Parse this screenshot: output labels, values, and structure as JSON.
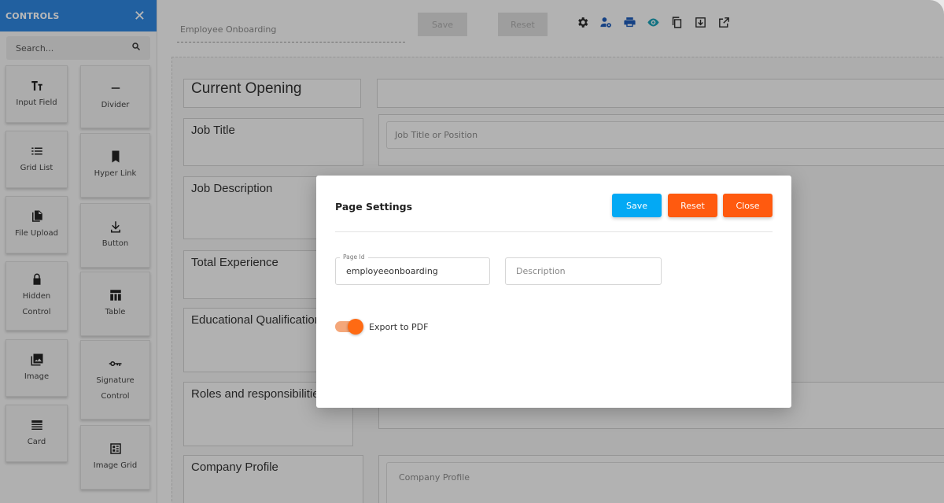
{
  "sidebar": {
    "title": "CONTROLS",
    "close_icon": "close-icon",
    "search_placeholder": "Search...",
    "controls": [
      {
        "label": "Input Field",
        "icon": "text-format-icon"
      },
      {
        "label": "Divider",
        "icon": "minus-icon"
      },
      {
        "label": "Grid List",
        "icon": "list-icon"
      },
      {
        "label": "Hyper Link",
        "icon": "bookmark-icon"
      },
      {
        "label": "File Upload",
        "icon": "file-copy-icon"
      },
      {
        "label": "Button",
        "icon": "download-icon"
      },
      {
        "label": "Hidden Control",
        "label_line1": "Hidden",
        "label_line2": "Control",
        "icon": "lock-icon"
      },
      {
        "label": "Table",
        "icon": "table-icon"
      },
      {
        "label": "Image",
        "icon": "image-icon"
      },
      {
        "label": "Signature Control",
        "label_line1": "Signature",
        "label_line2": "Control",
        "icon": "key-icon"
      },
      {
        "label": "Card",
        "icon": "card-icon"
      },
      {
        "label": "Image Grid",
        "icon": "image-grid-icon"
      }
    ]
  },
  "toolbar": {
    "page_name_value": "Employee Onboarding",
    "save_label": "Save",
    "reset_label": "Reset",
    "icons": [
      "settings-icon",
      "user-settings-icon",
      "print-icon",
      "preview-eye-icon",
      "copy-icon",
      "download-icon",
      "open-external-icon"
    ]
  },
  "form": {
    "rows": [
      {
        "label": "Current Opening",
        "placeholder": ""
      },
      {
        "label": "Job Title",
        "placeholder": "Job Title or Position"
      },
      {
        "label": "Job Description",
        "placeholder": ""
      },
      {
        "label": "Total Experience",
        "placeholder": ""
      },
      {
        "label": "Educational Qualification",
        "placeholder": ""
      },
      {
        "label": "Roles and responsibilities",
        "placeholder": ""
      },
      {
        "label": "Company Profile",
        "placeholder": "Company Profile"
      }
    ]
  },
  "modal": {
    "title": "Page Settings",
    "save_label": "Save",
    "reset_label": "Reset",
    "close_label": "Close",
    "page_id_label": "Page Id",
    "page_id_value": "employeeonboarding",
    "description_placeholder": "Description",
    "export_label": "Export to PDF",
    "export_enabled": true
  },
  "colors": {
    "sidebar_header": "#2e86de",
    "save_button": "#03a9f4",
    "reset_button": "#ff5a0f",
    "close_button": "#ff5a0f",
    "toggle": "#ff6a13"
  }
}
